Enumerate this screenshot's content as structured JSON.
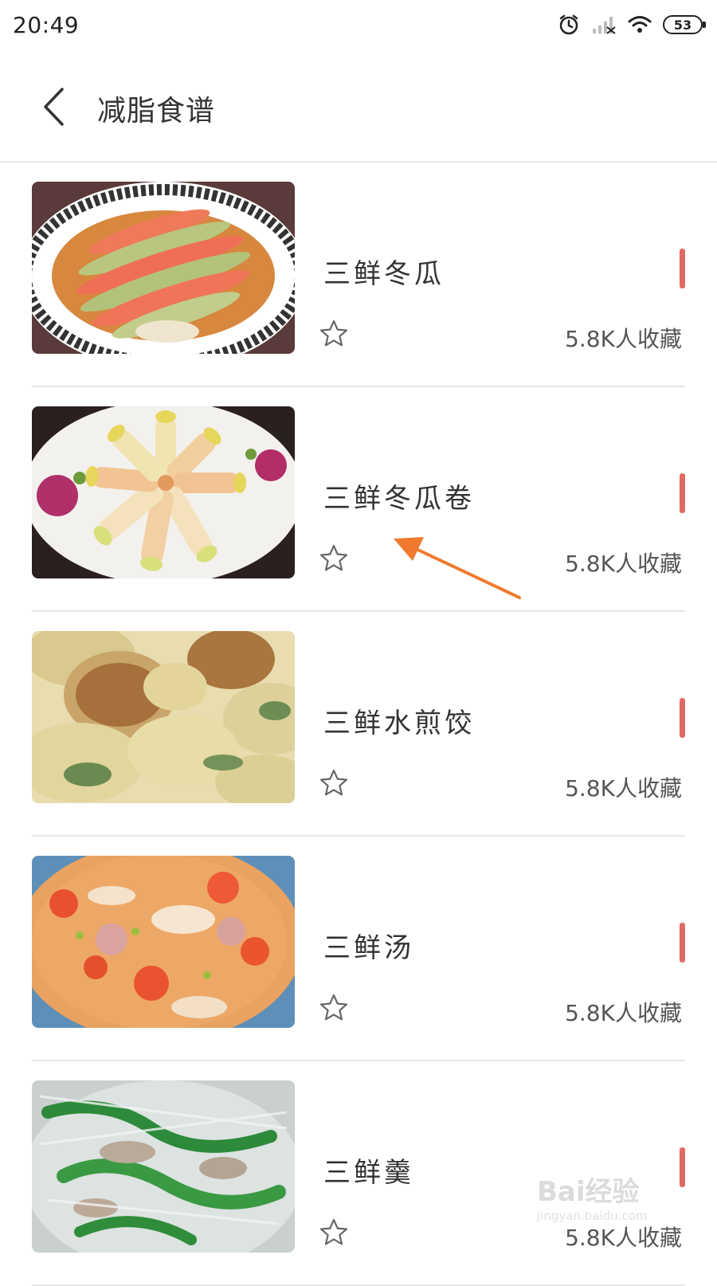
{
  "status": {
    "time": "20:49",
    "battery": "53"
  },
  "header": {
    "title": "减脂食谱"
  },
  "recipes": [
    {
      "name": "三鲜冬瓜",
      "collects": "5.8K人收藏"
    },
    {
      "name": "三鲜冬瓜卷",
      "collects": "5.8K人收藏"
    },
    {
      "name": "三鲜水煎饺",
      "collects": "5.8K人收藏"
    },
    {
      "name": "三鲜汤",
      "collects": "5.8K人收藏"
    },
    {
      "name": "三鲜羹",
      "collects": "5.8K人收藏"
    }
  ],
  "watermark": {
    "brand": "Bai经验",
    "sub": "jingyan.baidu.com"
  },
  "colors": {
    "accent_marker": "#e26a64",
    "annotation_arrow": "#f07a2e"
  },
  "icons": {
    "back": "chevron-left-icon",
    "star": "star-outline-icon",
    "alarm": "alarm-icon",
    "signal": "signal-icon",
    "wifi": "wifi-icon"
  }
}
